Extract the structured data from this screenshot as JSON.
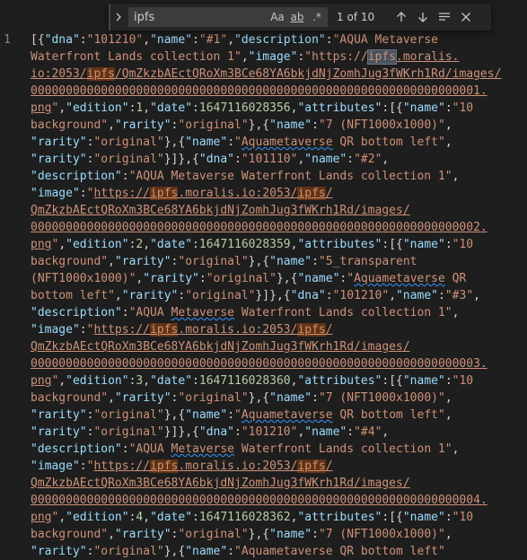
{
  "editor": {
    "line_number": "1",
    "lines": [
      [
        [
          "p",
          "[{"
        ],
        [
          "k",
          "\"dna\""
        ],
        [
          "p",
          ":"
        ],
        [
          "s",
          "\"101210\""
        ],
        [
          "p",
          ","
        ],
        [
          "k",
          "\"name\""
        ],
        [
          "p",
          ":"
        ],
        [
          "s",
          "\"#1\""
        ],
        [
          "p",
          ","
        ],
        [
          "k",
          "\"description\""
        ],
        [
          "p",
          ":"
        ],
        [
          "s",
          "\"AQUA Metaverse"
        ]
      ],
      [
        [
          "s",
          "Waterfront Lands collection 1\""
        ],
        [
          "p",
          ","
        ],
        [
          "k",
          "\"image\""
        ],
        [
          "p",
          ":"
        ],
        [
          "s",
          "\"https://"
        ],
        [
          "mc",
          "ipfs"
        ],
        [
          "su",
          ".moralis."
        ]
      ],
      [
        [
          "su",
          "io:2053/"
        ],
        [
          "msu",
          "ipfs"
        ],
        [
          "su",
          "/QmZkzbAEctQRoXm3BCe68YA6bkjdNjZomhJug3fWKrh1Rd/images/"
        ]
      ],
      [
        [
          "su",
          "0000000000000000000000000000000000000000000000000000000000000001."
        ]
      ],
      [
        [
          "su",
          "png"
        ],
        [
          "s",
          "\""
        ],
        [
          "p",
          ","
        ],
        [
          "k",
          "\"edition\""
        ],
        [
          "p",
          ":"
        ],
        [
          "n",
          "1"
        ],
        [
          "p",
          ","
        ],
        [
          "k",
          "\"date\""
        ],
        [
          "p",
          ":"
        ],
        [
          "n",
          "1647116028356"
        ],
        [
          "p",
          ","
        ],
        [
          "k",
          "\"attributes\""
        ],
        [
          "p",
          ":[{"
        ],
        [
          "k",
          "\"name\""
        ],
        [
          "p",
          ":"
        ],
        [
          "s",
          "\"10"
        ]
      ],
      [
        [
          "s",
          "background\""
        ],
        [
          "p",
          ","
        ],
        [
          "k",
          "\"rarity\""
        ],
        [
          "p",
          ":"
        ],
        [
          "s",
          "\"original\""
        ],
        [
          "p",
          "},{"
        ],
        [
          "k",
          "\"name\""
        ],
        [
          "p",
          ":"
        ],
        [
          "s",
          "\"7 (NFT1000x1000)\""
        ],
        [
          "p",
          ","
        ]
      ],
      [
        [
          "k",
          "\"rarity\""
        ],
        [
          "p",
          ":"
        ],
        [
          "s",
          "\"original\""
        ],
        [
          "p",
          "},{"
        ],
        [
          "k",
          "\"name\""
        ],
        [
          "p",
          ":"
        ],
        [
          "s",
          "\""
        ],
        [
          "sq",
          "Aquametaverse"
        ],
        [
          "s",
          " QR bottom left\""
        ],
        [
          "p",
          ","
        ]
      ],
      [
        [
          "k",
          "\"rarity\""
        ],
        [
          "p",
          ":"
        ],
        [
          "s",
          "\"original\""
        ],
        [
          "p",
          "}]},{"
        ],
        [
          "k",
          "\"dna\""
        ],
        [
          "p",
          ":"
        ],
        [
          "s",
          "\"101110\""
        ],
        [
          "p",
          ","
        ],
        [
          "k",
          "\"name\""
        ],
        [
          "p",
          ":"
        ],
        [
          "s",
          "\"#2\""
        ],
        [
          "p",
          ","
        ]
      ],
      [
        [
          "k",
          "\"description\""
        ],
        [
          "p",
          ":"
        ],
        [
          "s",
          "\"AQUA Metaverse Waterfront Lands collection 1\""
        ],
        [
          "p",
          ","
        ]
      ],
      [
        [
          "k",
          "\"image\""
        ],
        [
          "p",
          ":"
        ],
        [
          "s",
          "\""
        ],
        [
          "su",
          "https://"
        ],
        [
          "msu",
          "ipfs"
        ],
        [
          "su",
          ".moralis.io:2053/"
        ],
        [
          "msu",
          "ipfs"
        ],
        [
          "su",
          "/"
        ]
      ],
      [
        [
          "su",
          "QmZkzbAEctQRoXm3BCe68YA6bkjdNjZomhJug3fWKrh1Rd/images/"
        ]
      ],
      [
        [
          "su",
          "0000000000000000000000000000000000000000000000000000000000000002."
        ]
      ],
      [
        [
          "su",
          "png"
        ],
        [
          "s",
          "\""
        ],
        [
          "p",
          ","
        ],
        [
          "k",
          "\"edition\""
        ],
        [
          "p",
          ":"
        ],
        [
          "n",
          "2"
        ],
        [
          "p",
          ","
        ],
        [
          "k",
          "\"date\""
        ],
        [
          "p",
          ":"
        ],
        [
          "n",
          "1647116028359"
        ],
        [
          "p",
          ","
        ],
        [
          "k",
          "\"attributes\""
        ],
        [
          "p",
          ":[{"
        ],
        [
          "k",
          "\"name\""
        ],
        [
          "p",
          ":"
        ],
        [
          "s",
          "\"10"
        ]
      ],
      [
        [
          "s",
          "background\""
        ],
        [
          "p",
          ","
        ],
        [
          "k",
          "\"rarity\""
        ],
        [
          "p",
          ":"
        ],
        [
          "s",
          "\"original\""
        ],
        [
          "p",
          "},{"
        ],
        [
          "k",
          "\"name\""
        ],
        [
          "p",
          ":"
        ],
        [
          "s",
          "\"5_transparent"
        ]
      ],
      [
        [
          "s",
          "(NFT1000x1000)\""
        ],
        [
          "p",
          ","
        ],
        [
          "k",
          "\"rarity\""
        ],
        [
          "p",
          ":"
        ],
        [
          "s",
          "\"original\""
        ],
        [
          "p",
          "},{"
        ],
        [
          "k",
          "\"name\""
        ],
        [
          "p",
          ":"
        ],
        [
          "s",
          "\""
        ],
        [
          "sq",
          "Aquametaverse"
        ],
        [
          "s",
          " QR"
        ]
      ],
      [
        [
          "s",
          "bottom left\""
        ],
        [
          "p",
          ","
        ],
        [
          "k",
          "\"rarity\""
        ],
        [
          "p",
          ":"
        ],
        [
          "s",
          "\"original\""
        ],
        [
          "p",
          "}]},{"
        ],
        [
          "k",
          "\"dna\""
        ],
        [
          "p",
          ":"
        ],
        [
          "s",
          "\"101210\""
        ],
        [
          "p",
          ","
        ],
        [
          "k",
          "\"name\""
        ],
        [
          "p",
          ":"
        ],
        [
          "s",
          "\"#3\""
        ],
        [
          "p",
          ","
        ]
      ],
      [
        [
          "k",
          "\"description\""
        ],
        [
          "p",
          ":"
        ],
        [
          "s",
          "\"AQUA "
        ],
        [
          "sq",
          "Metaverse"
        ],
        [
          "s",
          " Waterfront Lands collection 1\""
        ],
        [
          "p",
          ","
        ]
      ],
      [
        [
          "k",
          "\"image\""
        ],
        [
          "p",
          ":"
        ],
        [
          "s",
          "\""
        ],
        [
          "su",
          "https://"
        ],
        [
          "msu",
          "ipfs"
        ],
        [
          "su",
          ".moralis.io:2053/"
        ],
        [
          "msu",
          "ipfs"
        ],
        [
          "su",
          "/"
        ]
      ],
      [
        [
          "su",
          "QmZkzbAEctQRoXm3BCe68YA6bkjdNjZomhJug3fWKrh1Rd/images/"
        ]
      ],
      [
        [
          "su",
          "0000000000000000000000000000000000000000000000000000000000000003."
        ]
      ],
      [
        [
          "su",
          "png"
        ],
        [
          "s",
          "\""
        ],
        [
          "p",
          ","
        ],
        [
          "k",
          "\"edition\""
        ],
        [
          "p",
          ":"
        ],
        [
          "n",
          "3"
        ],
        [
          "p",
          ","
        ],
        [
          "k",
          "\"date\""
        ],
        [
          "p",
          ":"
        ],
        [
          "n",
          "1647116028360"
        ],
        [
          "p",
          ","
        ],
        [
          "k",
          "\"attributes\""
        ],
        [
          "p",
          ":[{"
        ],
        [
          "k",
          "\"name\""
        ],
        [
          "p",
          ":"
        ],
        [
          "s",
          "\"10"
        ]
      ],
      [
        [
          "s",
          "background\""
        ],
        [
          "p",
          ","
        ],
        [
          "k",
          "\"rarity\""
        ],
        [
          "p",
          ":"
        ],
        [
          "s",
          "\"original\""
        ],
        [
          "p",
          "},{"
        ],
        [
          "k",
          "\"name\""
        ],
        [
          "p",
          ":"
        ],
        [
          "s",
          "\"7 (NFT1000x1000)\""
        ],
        [
          "p",
          ","
        ]
      ],
      [
        [
          "k",
          "\"rarity\""
        ],
        [
          "p",
          ":"
        ],
        [
          "s",
          "\"original\""
        ],
        [
          "p",
          "},{"
        ],
        [
          "k",
          "\"name\""
        ],
        [
          "p",
          ":"
        ],
        [
          "s",
          "\""
        ],
        [
          "sq",
          "Aquametaverse"
        ],
        [
          "s",
          " QR bottom left\""
        ],
        [
          "p",
          ","
        ]
      ],
      [
        [
          "k",
          "\"rarity\""
        ],
        [
          "p",
          ":"
        ],
        [
          "s",
          "\"original\""
        ],
        [
          "p",
          "}]},{"
        ],
        [
          "k",
          "\"dna\""
        ],
        [
          "p",
          ":"
        ],
        [
          "s",
          "\"101210\""
        ],
        [
          "p",
          ","
        ],
        [
          "k",
          "\"name\""
        ],
        [
          "p",
          ":"
        ],
        [
          "s",
          "\"#4\""
        ],
        [
          "p",
          ","
        ]
      ],
      [
        [
          "k",
          "\"description\""
        ],
        [
          "p",
          ":"
        ],
        [
          "s",
          "\"AQUA "
        ],
        [
          "sq",
          "Metaverse"
        ],
        [
          "s",
          " Waterfront Lands collection 1\""
        ],
        [
          "p",
          ","
        ]
      ],
      [
        [
          "k",
          "\"image\""
        ],
        [
          "p",
          ":"
        ],
        [
          "s",
          "\""
        ],
        [
          "su",
          "https://"
        ],
        [
          "msu",
          "ipfs"
        ],
        [
          "su",
          ".moralis.io:2053/"
        ],
        [
          "msu",
          "ipfs"
        ],
        [
          "su",
          "/"
        ]
      ],
      [
        [
          "su",
          "QmZkzbAEctQRoXm3BCe68YA6bkjdNjZomhJug3fWKrh1Rd/images/"
        ]
      ],
      [
        [
          "su",
          "0000000000000000000000000000000000000000000000000000000000000004."
        ]
      ],
      [
        [
          "su",
          "png"
        ],
        [
          "s",
          "\""
        ],
        [
          "p",
          ","
        ],
        [
          "k",
          "\"edition\""
        ],
        [
          "p",
          ":"
        ],
        [
          "n",
          "4"
        ],
        [
          "p",
          ","
        ],
        [
          "k",
          "\"date\""
        ],
        [
          "p",
          ":"
        ],
        [
          "n",
          "1647116028362"
        ],
        [
          "p",
          ","
        ],
        [
          "k",
          "\"attributes\""
        ],
        [
          "p",
          ":[{"
        ],
        [
          "k",
          "\"name\""
        ],
        [
          "p",
          ":"
        ],
        [
          "s",
          "\"10"
        ]
      ],
      [
        [
          "s",
          "background\""
        ],
        [
          "p",
          ","
        ],
        [
          "k",
          "\"rarity\""
        ],
        [
          "p",
          ":"
        ],
        [
          "s",
          "\"original\""
        ],
        [
          "p",
          "},{"
        ],
        [
          "k",
          "\"name\""
        ],
        [
          "p",
          ":"
        ],
        [
          "s",
          "\"7 (NFT1000x1000)\""
        ],
        [
          "p",
          ","
        ]
      ],
      [
        [
          "k",
          "\"rarity\""
        ],
        [
          "p",
          ":"
        ],
        [
          "s",
          "\"original\""
        ],
        [
          "p",
          "},{"
        ],
        [
          "k",
          "\"name\""
        ],
        [
          "p",
          ":"
        ],
        [
          "s",
          "\"Aquametaverse QR bottom left\""
        ]
      ]
    ]
  },
  "find_widget": {
    "query": "ipfs",
    "match_case_label": "Aa",
    "whole_word_label": "ab",
    "regex_label": ".*",
    "result_count": "1 of 10",
    "icons": [
      "chevron-right-icon",
      "arrow-up-icon",
      "arrow-down-icon",
      "find-in-selection-icon",
      "close-icon"
    ]
  },
  "colors": {
    "background": "#1e1e1e",
    "key": "#9cdcfe",
    "string": "#ce9178",
    "number": "#b5cea8",
    "match_highlight": "#ea5c00",
    "squiggle": "#3794ff"
  }
}
